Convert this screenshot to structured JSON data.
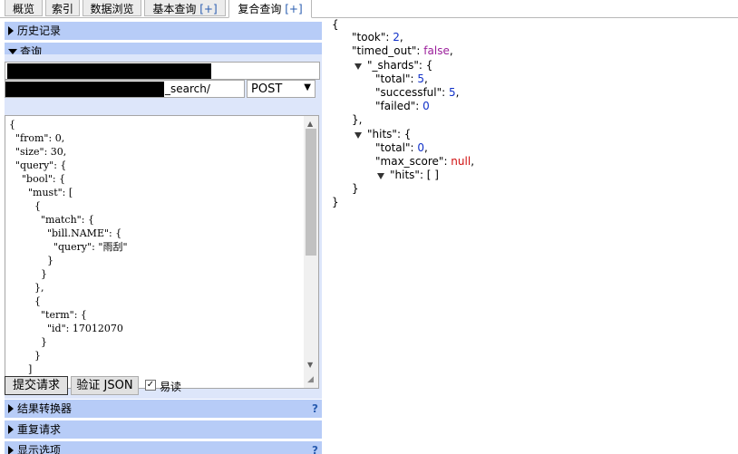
{
  "tabs": [
    {
      "label": "概览",
      "plus": ""
    },
    {
      "label": "索引",
      "plus": ""
    },
    {
      "label": "数据浏览",
      "plus": ""
    },
    {
      "label": "基本查询",
      "plus": "[+]"
    },
    {
      "label": "复合查询",
      "plus": "[+]"
    }
  ],
  "sections": {
    "history": "历史记录",
    "query": "查询",
    "transformer": "结果转换器",
    "repeat": "重复请求",
    "display": "显示选项",
    "help": "?"
  },
  "query": {
    "path_suffix": "_search/",
    "method": "POST",
    "body": "{\n  \"from\": 0,\n  \"size\": 30,\n  \"query\": {\n    \"bool\": {\n      \"must\": [\n        {\n          \"match\": {\n            \"bill.NAME\": {\n              \"query\": \"雨刮\"\n            }\n          }\n        },\n        {\n          \"term\": {\n            \"id\": 17012070\n          }\n        }\n      ]\n    }"
  },
  "buttons": {
    "submit": "提交请求",
    "validate": "验证 JSON",
    "easy_read": "易读",
    "easy_read_checked": true
  },
  "response": {
    "open_brace": "{",
    "took_key": "\"took\"",
    "took": "2",
    "timed_out_key": "\"timed_out\"",
    "timed_out": "false",
    "shards_key": "\"_shards\"",
    "total_key": "\"total\"",
    "shards_total": "5",
    "successful_key": "\"successful\"",
    "successful": "5",
    "failed_key": "\"failed\"",
    "failed": "0",
    "hits_key": "\"hits\"",
    "hits_total": "0",
    "max_score_key": "\"max_score\"",
    "max_score": "null",
    "inner_hits_key": "\"hits\"",
    "inner_hits_val": "[ ]",
    "close_brace": "}"
  },
  "colors": {
    "section_bg": "#b7ccf7",
    "panel_bg": "#dde6fa",
    "number": "#1030c8",
    "boolean": "#9b1e9b",
    "null": "#d01010"
  }
}
